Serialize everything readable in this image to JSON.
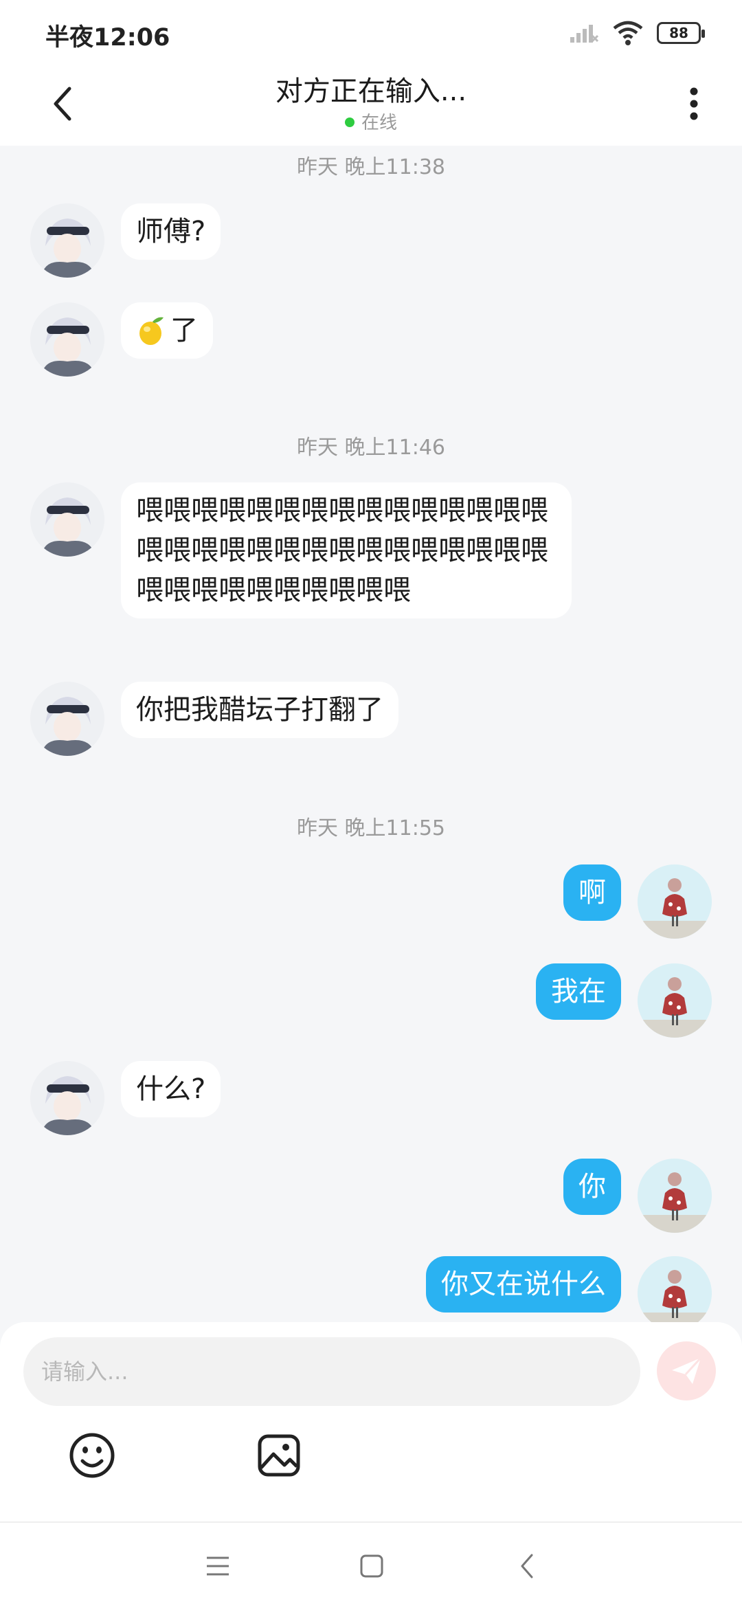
{
  "status_bar": {
    "time": "半夜12:06",
    "battery": "88"
  },
  "header": {
    "title": "对方正在输入...",
    "status": "在线"
  },
  "messages": [
    {
      "type": "time",
      "text": "昨天 晚上11:38"
    },
    {
      "side": "left",
      "text": "师傅?"
    },
    {
      "side": "left",
      "text": "了",
      "emoji": "lemon"
    },
    {
      "type": "time",
      "text": "昨天 晚上11:46"
    },
    {
      "side": "left",
      "text": "喂喂喂喂喂喂喂喂喂喂喂喂喂喂喂喂喂喂喂喂喂喂喂喂喂喂喂喂喂喂喂喂喂喂喂喂喂喂喂喂"
    },
    {
      "side": "left",
      "text": "你把我醋坛子打翻了"
    },
    {
      "type": "time",
      "text": "昨天 晚上11:55"
    },
    {
      "side": "right",
      "text": "啊"
    },
    {
      "side": "right",
      "text": "我在"
    },
    {
      "side": "left",
      "text": "什么?"
    },
    {
      "side": "right",
      "text": "你"
    },
    {
      "side": "right",
      "text": "你又在说什么"
    }
  ],
  "input": {
    "placeholder": "请输入..."
  },
  "colors": {
    "accent": "#2ab2f2",
    "online": "#2ecc40",
    "send_button": "#fde3e3"
  },
  "icons": [
    "back-arrow-icon",
    "more-vertical-icon",
    "emoji-icon",
    "image-icon",
    "send-icon",
    "menu-icon",
    "home-icon",
    "nav-back-icon",
    "lemon-emoji-icon"
  ]
}
